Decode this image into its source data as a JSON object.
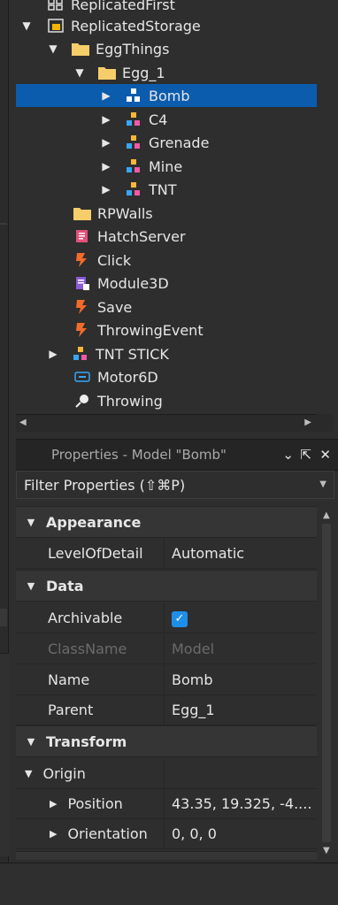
{
  "explorer": {
    "items": [
      {
        "label": "ReplicatedFirst",
        "icon": "replicated-first-icon"
      },
      {
        "label": "ReplicatedStorage",
        "icon": "replicated-storage-icon"
      },
      {
        "label": "EggThings",
        "icon": "folder-icon"
      },
      {
        "label": "Egg_1",
        "icon": "folder-icon"
      },
      {
        "label": "Bomb",
        "icon": "model-icon"
      },
      {
        "label": "C4",
        "icon": "model-icon"
      },
      {
        "label": "Grenade",
        "icon": "model-icon"
      },
      {
        "label": "Mine",
        "icon": "model-icon"
      },
      {
        "label": "TNT",
        "icon": "model-icon"
      },
      {
        "label": "RPWalls",
        "icon": "folder-icon"
      },
      {
        "label": "HatchServer",
        "icon": "script-icon"
      },
      {
        "label": "Click",
        "icon": "remote-event-icon"
      },
      {
        "label": "Module3D",
        "icon": "module-script-icon"
      },
      {
        "label": "Save",
        "icon": "remote-event-icon"
      },
      {
        "label": "ThrowingEvent",
        "icon": "remote-event-icon"
      },
      {
        "label": "TNT STICK",
        "icon": "model-icon"
      },
      {
        "label": "Motor6D",
        "icon": "motor6d-icon"
      },
      {
        "label": "Throwing",
        "icon": "animation-icon"
      }
    ]
  },
  "properties": {
    "title": "Properties - Model \"Bomb\"",
    "filter_label": "Filter Properties (⇧⌘P)",
    "sections": {
      "appearance": "Appearance",
      "data": "Data",
      "transform": "Transform"
    },
    "rows": {
      "level_of_detail": {
        "name": "LevelOfDetail",
        "value": "Automatic"
      },
      "archivable": {
        "name": "Archivable",
        "value": true
      },
      "class_name": {
        "name": "ClassName",
        "value": "Model"
      },
      "name": {
        "name": "Name",
        "value": "Bomb"
      },
      "parent": {
        "name": "Parent",
        "value": "Egg_1"
      },
      "origin": {
        "name": "Origin"
      },
      "position": {
        "name": "Position",
        "value": "43.35, 19.325, -4...."
      },
      "orientation": {
        "name": "Orientation",
        "value": "0, 0, 0"
      }
    }
  },
  "colors": {
    "selection": "#0b5cad",
    "checkbox": "#1f8ee8",
    "background": "#2e2e2e"
  }
}
